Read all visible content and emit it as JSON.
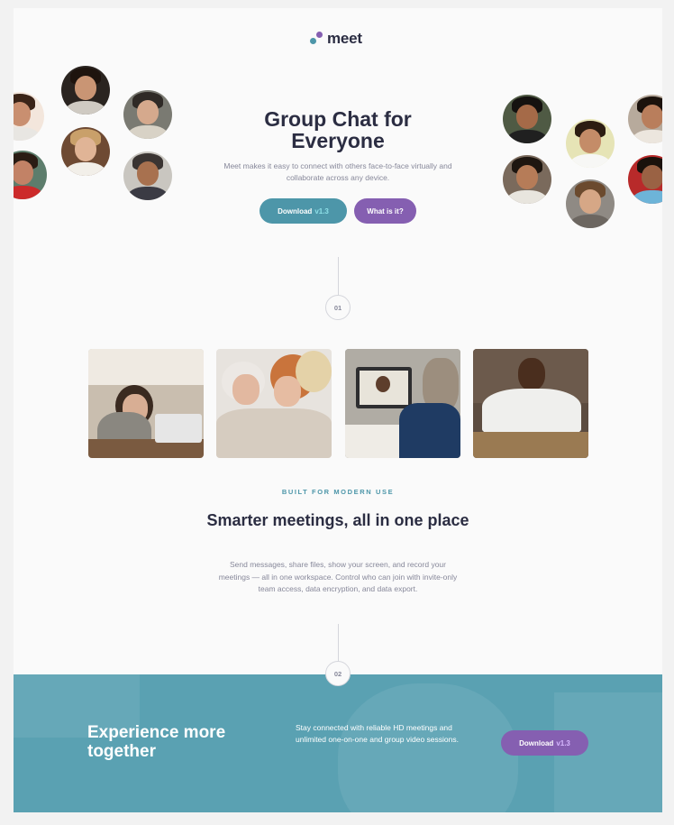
{
  "brand": {
    "name": "meet"
  },
  "hero": {
    "title": "Group Chat for Everyone",
    "description": "Meet makes it easy to connect with others face-to-face virtually and collaborate across any device.",
    "download_label": "Download",
    "download_version": "v1.3",
    "whatis_label": "What is it?"
  },
  "steps": {
    "first": "01",
    "second": "02"
  },
  "features": {
    "eyebrow": "BUILT FOR MODERN USE",
    "title": "Smarter meetings, all in one place",
    "description": "Send messages, share files, show your screen, and record your meetings — all in one workspace. Control who can join with invite-only team access, data encryption, and data export."
  },
  "cta": {
    "title": "Experience more together",
    "description": "Stay connected with reliable HD meetings and unlimited one-on-one and group video sessions.",
    "download_label": "Download",
    "download_version": "v1.3"
  },
  "colors": {
    "teal": "#4d96a9",
    "purple": "#855fb1",
    "dark": "#2b2d42",
    "muted": "#87889a",
    "band": "#5aa1b2"
  }
}
